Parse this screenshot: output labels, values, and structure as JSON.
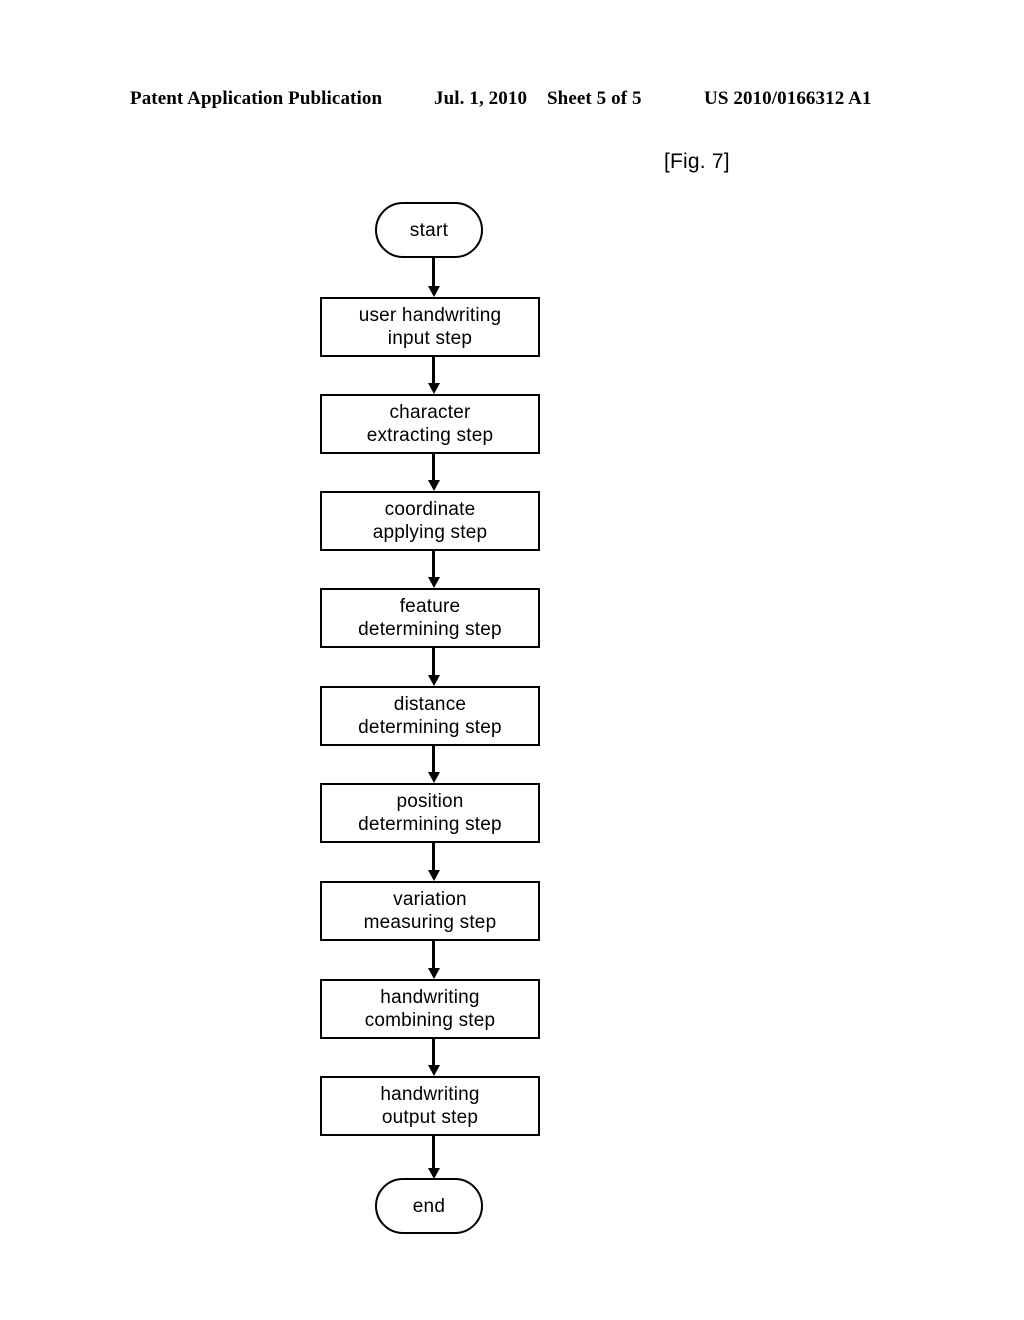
{
  "header": {
    "publication": "Patent Application Publication",
    "date": "Jul. 1, 2010",
    "sheet": "Sheet 5 of 5",
    "patent_number": "US 2010/0166312 A1"
  },
  "figure": {
    "label": "[Fig. 7]"
  },
  "flowchart": {
    "start_label": "start",
    "end_label": "end",
    "steps": [
      {
        "line1": "user handwriting",
        "line2": "input step",
        "text": "user handwriting\ninput step"
      },
      {
        "line1": "character",
        "line2": "extracting step",
        "text": "character\nextracting step"
      },
      {
        "line1": "coordinate",
        "line2": "applying step",
        "text": "coordinate\napplying step"
      },
      {
        "line1": "feature",
        "line2": "determining step",
        "text": "feature\ndetermining step"
      },
      {
        "line1": "distance",
        "line2": "determining step",
        "text": "distance\ndetermining step"
      },
      {
        "line1": "position",
        "line2": "determining step",
        "text": "position\ndetermining step"
      },
      {
        "line1": "variation",
        "line2": "measuring step",
        "text": "variation\nmeasuring step"
      },
      {
        "line1": "handwriting",
        "line2": "combining step",
        "text": "handwriting\ncombining step"
      },
      {
        "line1": "handwriting",
        "line2": "output step",
        "text": "handwriting\noutput step"
      }
    ],
    "colors": {
      "stroke": "#000000",
      "fill": "#ffffff"
    }
  }
}
